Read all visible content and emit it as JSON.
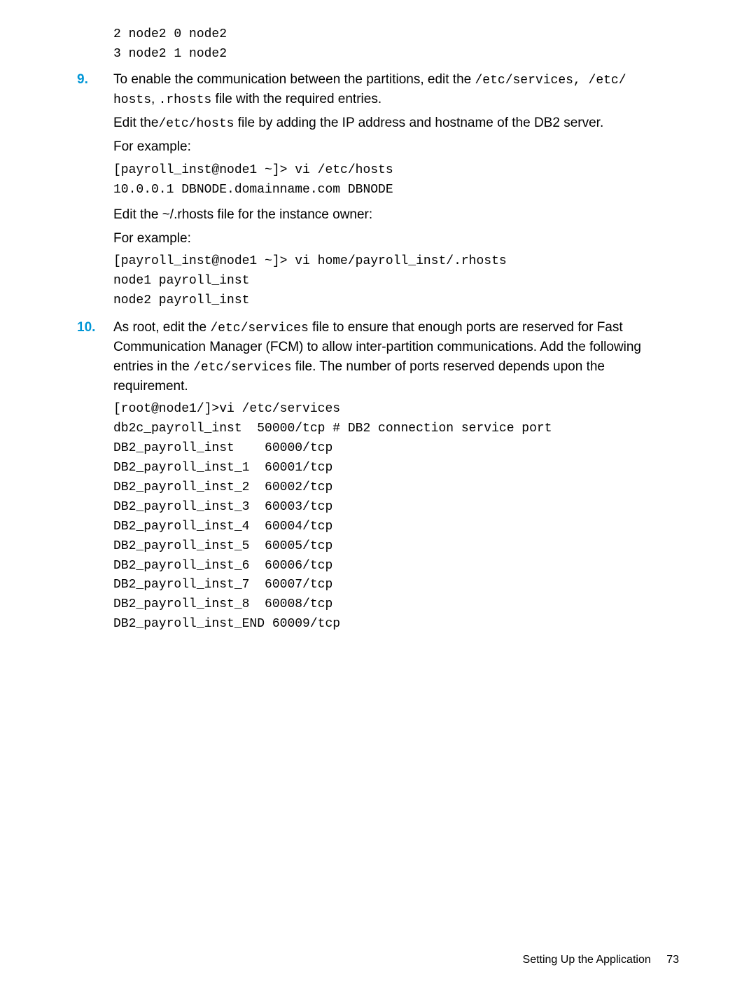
{
  "preCode": "2 node2 0 node2\n3 node2 1 node2",
  "step9": {
    "num": "9.",
    "intro_pre": "To enable the communication between the partitions, edit the ",
    "intro_code1": "/etc/services,  /etc/",
    "intro_code2": "hosts",
    "intro_mid": ", ",
    "intro_code3": ".rhosts",
    "intro_post": " file with the required entries.",
    "editHosts_pre": "Edit the",
    "editHosts_code": "/etc/hosts",
    "editHosts_post": " file by adding the IP address and hostname of the DB2 server.",
    "forExample1": "For example:",
    "codeHosts": "[payroll_inst@node1 ~]> vi /etc/hosts\n10.0.0.1 DBNODE.domainname.com DBNODE",
    "editRhosts": "Edit the ~/.rhosts file for the instance owner:",
    "forExample2": "For example:",
    "codeRhosts": "[payroll_inst@node1 ~]> vi home/payroll_inst/.rhosts\nnode1 payroll_inst\nnode2 payroll_inst"
  },
  "step10": {
    "num": "10.",
    "intro_pre": "As root, edit the ",
    "intro_code1": "/etc/services",
    "intro_mid": " file to ensure that enough ports are reserved for Fast Communication Manager (FCM) to allow inter-partition communications. Add the following entries in the ",
    "intro_code2": "/etc/services",
    "intro_post": " file. The number of ports reserved depends upon the requirement.",
    "codeServices": "[root@node1/]>vi /etc/services\ndb2c_payroll_inst  50000/tcp # DB2 connection service port\nDB2_payroll_inst    60000/tcp\nDB2_payroll_inst_1  60001/tcp\nDB2_payroll_inst_2  60002/tcp\nDB2_payroll_inst_3  60003/tcp\nDB2_payroll_inst_4  60004/tcp\nDB2_payroll_inst_5  60005/tcp\nDB2_payroll_inst_6  60006/tcp\nDB2_payroll_inst_7  60007/tcp\nDB2_payroll_inst_8  60008/tcp\nDB2_payroll_inst_END 60009/tcp"
  },
  "footer": {
    "section": "Setting Up the Application",
    "page": "73"
  }
}
